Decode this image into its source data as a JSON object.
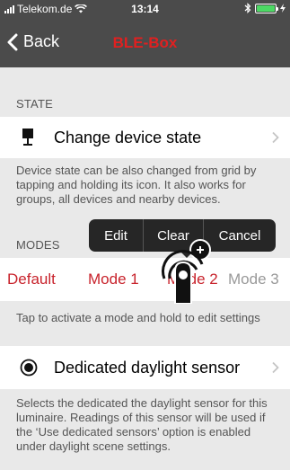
{
  "status_bar": {
    "carrier": "Telekom.de",
    "time": "13:14"
  },
  "nav": {
    "back_label": "Back",
    "title": "BLE-Box",
    "title_color": "#e02020"
  },
  "state_section": {
    "header": "STATE",
    "cell_label": "Change device state",
    "cell_icon": "lamp-icon",
    "footer": "Device state can be also changed from grid by tapping and holding its icon. It also works for groups, all devices and nearby devices."
  },
  "modes_section": {
    "header": "MODES",
    "modes": [
      "Default",
      "Mode 1",
      "Mode 2",
      "Mode 3"
    ],
    "active_color": "#c8232c",
    "footer": "Tap to activate a mode and hold to edit settings"
  },
  "context_menu": {
    "items": [
      "Edit",
      "Clear",
      "Cancel"
    ]
  },
  "sensor_section": {
    "cell_label": "Dedicated daylight sensor",
    "cell_icon": "sensor-icon",
    "footer": "Selects the dedicated the daylight sensor for this luminaire. Readings of this sensor will be used if the ‘Use dedicated sensors’ option is enabled under daylight scene settings."
  }
}
